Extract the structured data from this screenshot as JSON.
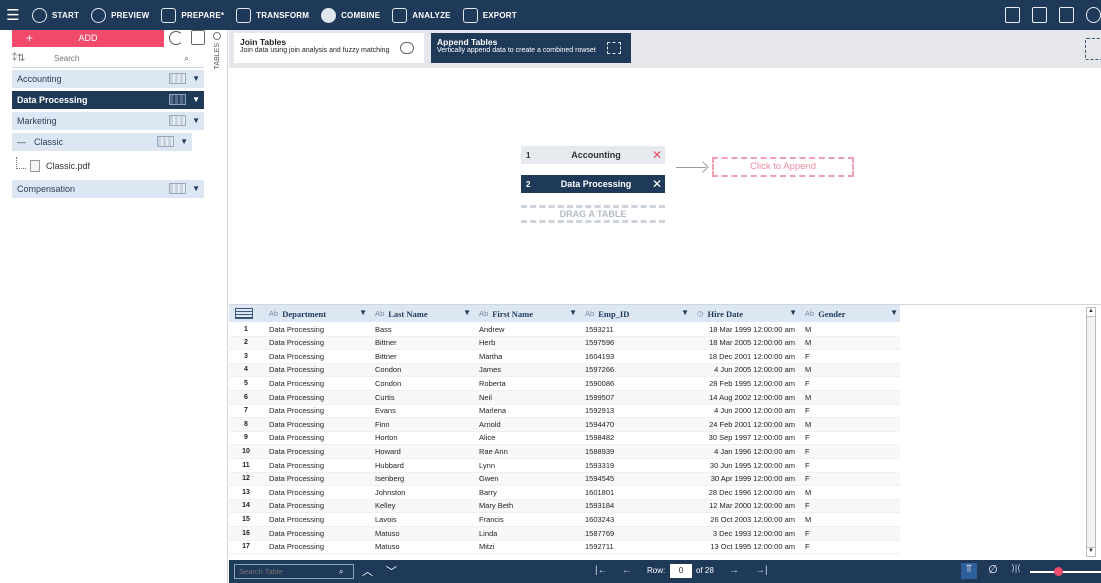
{
  "toolbar": {
    "items": [
      {
        "label": "START",
        "icon": "cube-icon"
      },
      {
        "label": "PREVIEW",
        "icon": "eye-icon"
      },
      {
        "label": "PREPARE*",
        "icon": "table-icon"
      },
      {
        "label": "TRANSFORM",
        "icon": "transform-icon"
      },
      {
        "label": "COMBINE",
        "icon": "combine-icon",
        "active": true
      },
      {
        "label": "ANALYZE",
        "icon": "analyze-icon"
      },
      {
        "label": "EXPORT",
        "icon": "export-icon"
      }
    ]
  },
  "left": {
    "add_label": "ADD",
    "search_placeholder": "Search",
    "tables_label": "TABLES",
    "items": [
      {
        "label": "Accounting"
      },
      {
        "label": "Data Processing"
      },
      {
        "label": "Marketing"
      },
      {
        "label": "Classic"
      },
      {
        "label": "Classic.pdf"
      },
      {
        "label": "Compensation"
      }
    ]
  },
  "combine": {
    "join_title": "Join Tables",
    "join_sub": "Join data using join analysis and fuzzy matching",
    "append_title": "Append Tables",
    "append_sub": "Vertically append data to create a combined rowset"
  },
  "append_area": {
    "table1_num": "1",
    "table1_name": "Accounting",
    "table2_num": "2",
    "table2_name": "Data Processing",
    "drag_label": "DRAG A TABLE",
    "click_label": "Click to Append"
  },
  "grid": {
    "columns": [
      {
        "type": "Ab",
        "name": "Department"
      },
      {
        "type": "Ab",
        "name": "Last Name"
      },
      {
        "type": "Ab",
        "name": "First Name"
      },
      {
        "type": "Ab",
        "name": "Emp_ID"
      },
      {
        "type": "◷",
        "name": "Hire Date"
      },
      {
        "type": "Ab",
        "name": "Gender"
      }
    ],
    "rows": [
      [
        "1",
        "Data Processing",
        "Bass",
        "Andrew",
        "1593211",
        "18 Mar 1999 12:00:00 am",
        "M"
      ],
      [
        "2",
        "Data Processing",
        "Bittner",
        "Herb",
        "1597596",
        "18 Mar 2005 12:00:00 am",
        "M"
      ],
      [
        "3",
        "Data Processing",
        "Bittner",
        "Martha",
        "1604193",
        "18 Dec 2001 12:00:00 am",
        "F"
      ],
      [
        "4",
        "Data Processing",
        "Condon",
        "James",
        "1597266",
        "4 Jun 2005 12:00:00 am",
        "M"
      ],
      [
        "5",
        "Data Processing",
        "Condon",
        "Roberta",
        "1590086",
        "28 Feb 1995 12:00:00 am",
        "F"
      ],
      [
        "6",
        "Data Processing",
        "Curtis",
        "Neil",
        "1599507",
        "14 Aug 2002 12:00:00 am",
        "M"
      ],
      [
        "7",
        "Data Processing",
        "Evans",
        "Marlena",
        "1592913",
        "4 Jun 2000 12:00:00 am",
        "F"
      ],
      [
        "8",
        "Data Processing",
        "Finn",
        "Arnold",
        "1594470",
        "24 Feb 2001 12:00:00 am",
        "M"
      ],
      [
        "9",
        "Data Processing",
        "Horton",
        "Alice",
        "1598482",
        "30 Sep 1997 12:00:00 am",
        "F"
      ],
      [
        "10",
        "Data Processing",
        "Howard",
        "Rae Ann",
        "1588939",
        "4 Jan 1996 12:00:00 am",
        "F"
      ],
      [
        "11",
        "Data Processing",
        "Hubbard",
        "Lynn",
        "1593319",
        "30 Jun 1995 12:00:00 am",
        "F"
      ],
      [
        "12",
        "Data Processing",
        "Isenberg",
        "Gwen",
        "1594545",
        "30 Apr 1999 12:00:00 am",
        "F"
      ],
      [
        "13",
        "Data Processing",
        "Johnston",
        "Barry",
        "1601801",
        "28 Dec 1996 12:00:00 am",
        "M"
      ],
      [
        "14",
        "Data Processing",
        "Kelley",
        "Mary Beth",
        "1593184",
        "12 Mar 2000 12:00:00 am",
        "F"
      ],
      [
        "15",
        "Data Processing",
        "Lavois",
        "Francis",
        "1603243",
        "26 Oct 2003 12:00:00 am",
        "M"
      ],
      [
        "16",
        "Data Processing",
        "Matuso",
        "Linda",
        "1587769",
        "3 Dec 1993 12:00:00 am",
        "F"
      ],
      [
        "17",
        "Data Processing",
        "Matuso",
        "Mitzi",
        "1592711",
        "13 Oct 1995 12:00:00 am",
        "F"
      ]
    ]
  },
  "bottom": {
    "search_placeholder": "Search Table",
    "row_label": "Row:",
    "row_value": "0",
    "of_label": "of 28",
    "zoom_level": 0.4
  }
}
